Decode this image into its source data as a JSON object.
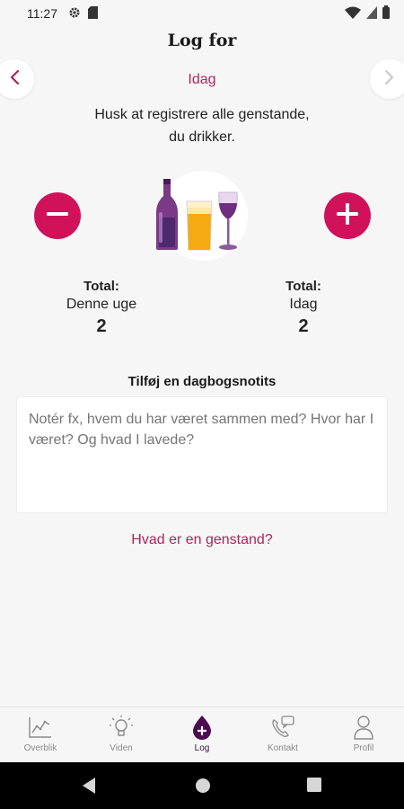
{
  "status_bar": {
    "time": "11:27",
    "icons": [
      "gear-icon",
      "sim-card-icon",
      "wifi-icon",
      "signal-icon",
      "battery-icon"
    ]
  },
  "header": {
    "title": "Log for",
    "date_label": "Idag",
    "prev_icon": "chevron-left-icon",
    "next_icon": "chevron-right-icon"
  },
  "reminder": {
    "line1": "Husk at registrere alle genstande,",
    "line2": "du drikker."
  },
  "counter": {
    "minus_icon": "minus-icon",
    "plus_icon": "plus-icon",
    "illustration": "drinks-illustration"
  },
  "totals": {
    "week": {
      "heading": "Total:",
      "label": "Denne uge",
      "value": "2"
    },
    "today": {
      "heading": "Total:",
      "label": "Idag",
      "value": "2"
    }
  },
  "notes": {
    "heading": "Tilføj en dagbogsnotits",
    "placeholder": "Notér fx, hvem du har været sammen med? Hvor har I været? Og hvad I lavede?"
  },
  "help_link": "Hvad er en genstand?",
  "bottom_nav": {
    "active": "Log",
    "tabs": [
      {
        "label": "Overblik",
        "icon": "chart-icon"
      },
      {
        "label": "Viden",
        "icon": "lightbulb-icon"
      },
      {
        "label": "Log",
        "icon": "drop-plus-icon"
      },
      {
        "label": "Kontakt",
        "icon": "phone-chat-icon"
      },
      {
        "label": "Profil",
        "icon": "person-icon"
      }
    ]
  },
  "colors": {
    "accent": "#d0125a",
    "accent_text": "#b0245c",
    "active_tab": "#3b1042",
    "background": "#f6f6f6"
  }
}
